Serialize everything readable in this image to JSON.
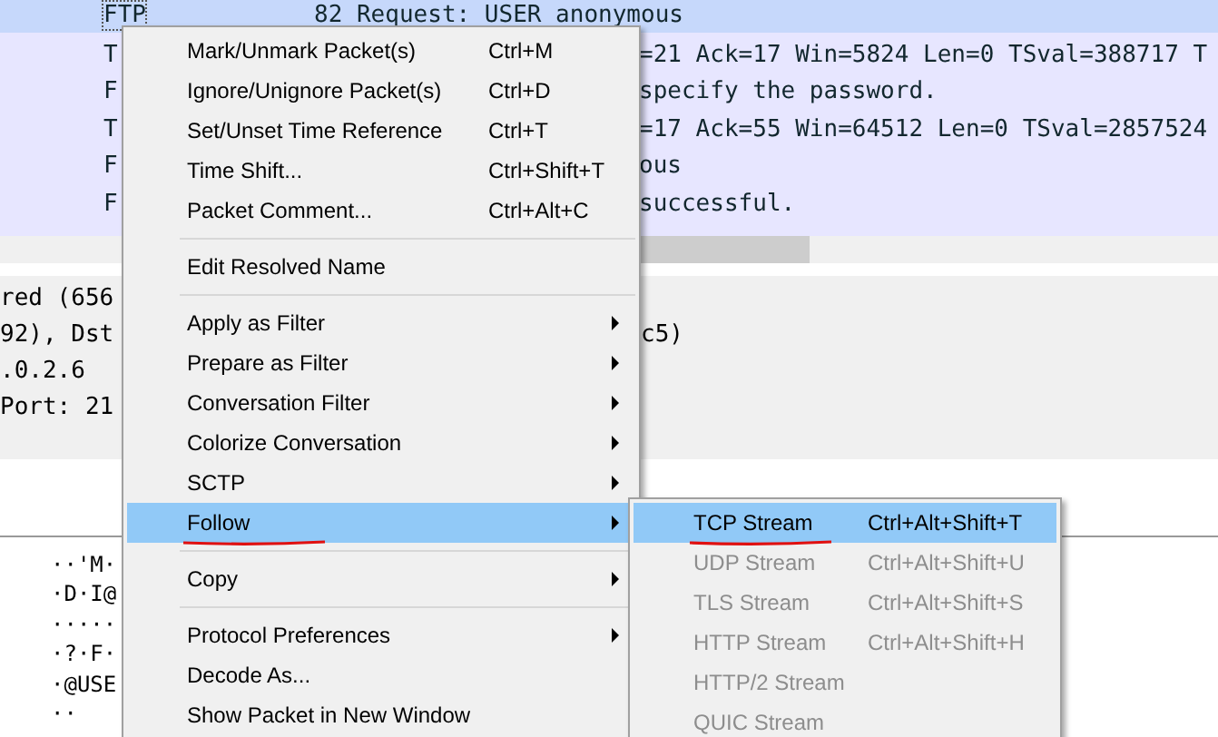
{
  "packet_list": {
    "rows": [
      {
        "protocol": "FTP",
        "info": "82 Request: USER anonymous",
        "selected": true
      },
      {
        "protocol": "T",
        "info": "=21 Ack=17 Win=5824 Len=0 TSval=388717 T",
        "selected": false
      },
      {
        "protocol": "F",
        "info": "specify the password.",
        "selected": false
      },
      {
        "protocol": "T",
        "info": "=17 Ack=55 Win=64512 Len=0 TSval=2857524",
        "selected": false
      },
      {
        "protocol": "F",
        "info": "ous",
        "selected": false
      },
      {
        "protocol": "F",
        "info": "successful.",
        "selected": false
      }
    ]
  },
  "packet_details": {
    "lines": [
      {
        "text": "red (656"
      },
      {
        "text": "92), Dst",
        "tail": "c5)"
      },
      {
        "text": ".0.2.6"
      },
      {
        "text": "Port: 21"
      }
    ]
  },
  "packet_bytes": {
    "lines": [
      "··'M·",
      "·D·I@",
      "·····",
      "·?·F·",
      "·@USE",
      "··"
    ]
  },
  "context_menu": {
    "items": [
      {
        "kind": "item",
        "label": "Mark/Unmark Packet(s)",
        "shortcut": "Ctrl+M",
        "has_submenu": false,
        "selected": false
      },
      {
        "kind": "item",
        "label": "Ignore/Unignore Packet(s)",
        "shortcut": "Ctrl+D",
        "has_submenu": false,
        "selected": false
      },
      {
        "kind": "item",
        "label": "Set/Unset Time Reference",
        "shortcut": "Ctrl+T",
        "has_submenu": false,
        "selected": false
      },
      {
        "kind": "item",
        "label": "Time Shift...",
        "shortcut": "Ctrl+Shift+T",
        "has_submenu": false,
        "selected": false
      },
      {
        "kind": "item",
        "label": "Packet Comment...",
        "shortcut": "Ctrl+Alt+C",
        "has_submenu": false,
        "selected": false
      },
      {
        "kind": "separator"
      },
      {
        "kind": "item",
        "label": "Edit Resolved Name",
        "has_submenu": false,
        "selected": false
      },
      {
        "kind": "separator"
      },
      {
        "kind": "item",
        "label": "Apply as Filter",
        "has_submenu": true,
        "selected": false
      },
      {
        "kind": "item",
        "label": "Prepare as Filter",
        "has_submenu": true,
        "selected": false
      },
      {
        "kind": "item",
        "label": "Conversation Filter",
        "has_submenu": true,
        "selected": false
      },
      {
        "kind": "item",
        "label": "Colorize Conversation",
        "has_submenu": true,
        "selected": false
      },
      {
        "kind": "item",
        "label": "SCTP",
        "has_submenu": true,
        "selected": false
      },
      {
        "kind": "item",
        "label": "Follow",
        "has_submenu": true,
        "selected": true,
        "underlined": true
      },
      {
        "kind": "separator"
      },
      {
        "kind": "item",
        "label": "Copy",
        "has_submenu": true,
        "selected": false
      },
      {
        "kind": "separator"
      },
      {
        "kind": "item",
        "label": "Protocol Preferences",
        "has_submenu": true,
        "selected": false
      },
      {
        "kind": "item",
        "label": "Decode As...",
        "has_submenu": false,
        "selected": false
      },
      {
        "kind": "item",
        "label": "Show Packet in New Window",
        "has_submenu": false,
        "selected": false
      }
    ]
  },
  "follow_submenu": {
    "items": [
      {
        "label": "TCP Stream",
        "shortcut": "Ctrl+Alt+Shift+T",
        "selected": true,
        "disabled": false,
        "underlined": true
      },
      {
        "label": "UDP Stream",
        "shortcut": "Ctrl+Alt+Shift+U",
        "selected": false,
        "disabled": true
      },
      {
        "label": "TLS Stream",
        "shortcut": "Ctrl+Alt+Shift+S",
        "selected": false,
        "disabled": true
      },
      {
        "label": "HTTP Stream",
        "shortcut": "Ctrl+Alt+Shift+H",
        "selected": false,
        "disabled": true
      },
      {
        "label": "HTTP/2 Stream",
        "selected": false,
        "disabled": true
      },
      {
        "label": "QUIC Stream",
        "selected": false,
        "disabled": true
      }
    ]
  }
}
